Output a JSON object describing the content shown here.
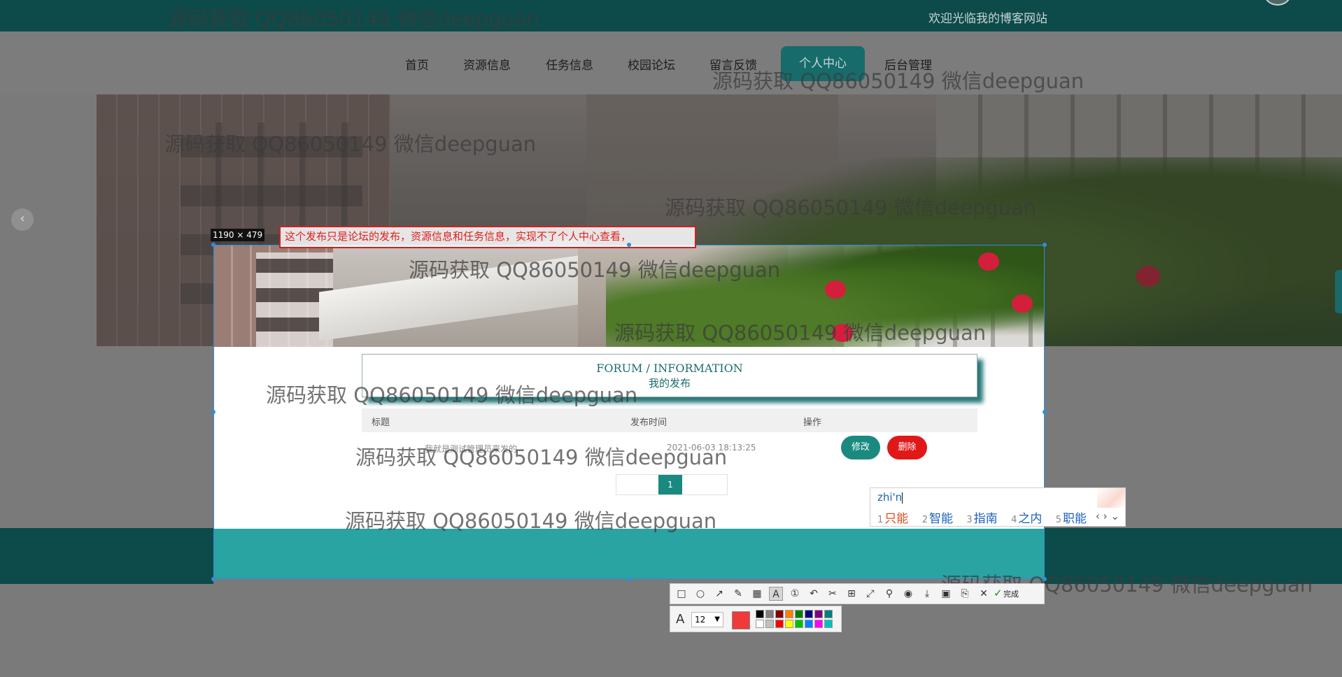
{
  "header": {
    "welcome": "欢迎光临我的博客网站"
  },
  "nav": {
    "items": [
      "首页",
      "资源信息",
      "任务信息",
      "校园论坛",
      "留言反馈",
      "个人中心",
      "后台管理"
    ],
    "active_index": 5
  },
  "carousel": {
    "prev_icon": "‹"
  },
  "watermark": "源码获取 QQ86050149 微信deepguan",
  "selection": {
    "size_label": "1190 × 479"
  },
  "forum": {
    "title": "FORUM / INFORMATION",
    "subtitle": "我的发布"
  },
  "table": {
    "headers": [
      "标题",
      "发布时间",
      "操作"
    ],
    "rows": [
      {
        "title": "我就是测试管理员来发的",
        "time": "2021-06-03 18:13:25",
        "edit": "修改",
        "delete": "删除"
      }
    ]
  },
  "pagination": {
    "current": "1"
  },
  "annotation": {
    "text": "这个发布只是论坛的发布，资源信息和任务信息，实现不了个人中心查看，"
  },
  "ime": {
    "pinyin": "zhi'n",
    "candidates": [
      {
        "num": "1",
        "text": "只能"
      },
      {
        "num": "2",
        "text": "智能"
      },
      {
        "num": "3",
        "text": "指南"
      },
      {
        "num": "4",
        "text": "之内"
      },
      {
        "num": "5",
        "text": "职能"
      }
    ],
    "nav": "‹ › ⌄"
  },
  "toolbar": {
    "done_label": "完成",
    "font_size": "12",
    "current_color": "#f03a3a",
    "palette": [
      "#000000",
      "#808080",
      "#800000",
      "#ff8000",
      "#008000",
      "#000080",
      "#800080",
      "#008080",
      "#ffffff",
      "#c0c0c0",
      "#ff0000",
      "#ffff00",
      "#00c000",
      "#0080ff",
      "#ff00ff",
      "#00c0c0"
    ]
  },
  "colors": {
    "header_bg": "#0d4a4a",
    "accent": "#1a8a80",
    "danger": "#e01818",
    "footer_bg": "#2aa3a3"
  }
}
